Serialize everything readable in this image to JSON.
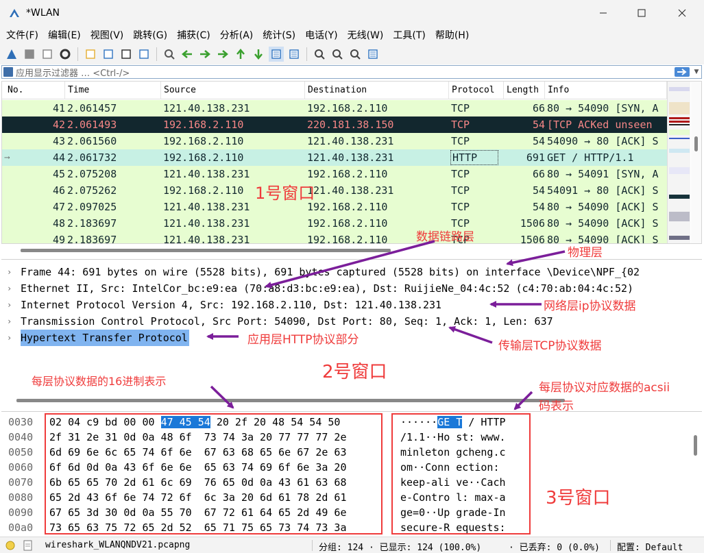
{
  "window": {
    "title": "*WLAN"
  },
  "menu": [
    "文件(F)",
    "编辑(E)",
    "视图(V)",
    "跳转(G)",
    "捕获(C)",
    "分析(A)",
    "统计(S)",
    "电话(Y)",
    "无线(W)",
    "工具(T)",
    "帮助(H)"
  ],
  "toolbar": [
    "shark-fin-start-icon",
    "stop-icon",
    "restart-icon",
    "options-gear-icon",
    "open-folder-icon",
    "save-file-icon",
    "close-file-icon",
    "reload-icon",
    "find-icon",
    "back-arrow-icon",
    "forward-arrow-icon",
    "go-to-packet-icon",
    "first-packet-icon",
    "last-packet-icon",
    "autoscroll-icon",
    "colorize-icon",
    "zoom-in-icon",
    "zoom-out-icon",
    "normal-size-icon",
    "resize-columns-icon"
  ],
  "filter": {
    "placeholder": "应用显示过滤器 … <Ctrl-/>"
  },
  "packet_list": {
    "columns": [
      "No.",
      "Time",
      "Source",
      "Destination",
      "Protocol",
      "Length",
      "Info"
    ],
    "rows": [
      {
        "no": "41",
        "time": "2.061457",
        "src": "121.40.138.231",
        "dst": "192.168.2.110",
        "proto": "TCP",
        "len": "66",
        "info": "80 → 54090 [SYN, A",
        "style": "tcp"
      },
      {
        "no": "42",
        "time": "2.061493",
        "src": "192.168.2.110",
        "dst": "220.181.38.150",
        "proto": "TCP",
        "len": "54",
        "info": "[TCP ACKed unseen",
        "style": "bad"
      },
      {
        "no": "43",
        "time": "2.061560",
        "src": "192.168.2.110",
        "dst": "121.40.138.231",
        "proto": "TCP",
        "len": "54",
        "info": "54090 → 80 [ACK] S",
        "style": "tcp"
      },
      {
        "no": "44",
        "time": "2.061732",
        "src": "192.168.2.110",
        "dst": "121.40.138.231",
        "proto": "HTTP",
        "len": "691",
        "info": "GET / HTTP/1.1",
        "style": "http"
      },
      {
        "no": "45",
        "time": "2.075208",
        "src": "121.40.138.231",
        "dst": "192.168.2.110",
        "proto": "TCP",
        "len": "66",
        "info": "80 → 54091 [SYN, A",
        "style": "tcp"
      },
      {
        "no": "46",
        "time": "2.075262",
        "src": "192.168.2.110",
        "dst": "121.40.138.231",
        "proto": "TCP",
        "len": "54",
        "info": "54091 → 80 [ACK] S",
        "style": "tcp"
      },
      {
        "no": "47",
        "time": "2.097025",
        "src": "121.40.138.231",
        "dst": "192.168.2.110",
        "proto": "TCP",
        "len": "54",
        "info": "80 → 54090 [ACK] S",
        "style": "tcp"
      },
      {
        "no": "48",
        "time": "2.183697",
        "src": "121.40.138.231",
        "dst": "192.168.2.110",
        "proto": "TCP",
        "len": "1506",
        "info": "80 → 54090 [ACK] S",
        "style": "tcp"
      },
      {
        "no": "49",
        "time": "2.183697",
        "src": "121.40.138.231",
        "dst": "192.168.2.110",
        "proto": "TCP",
        "len": "1506",
        "info": "80 → 54090 [ACK] S",
        "style": "tcp"
      }
    ]
  },
  "details": [
    "Frame 44: 691 bytes on wire (5528 bits), 691 bytes captured (5528 bits) on interface \\Device\\NPF_{02",
    "Ethernet II, Src: IntelCor_bc:e9:ea (70:a8:d3:bc:e9:ea), Dst: RuijieNe_04:4c:52 (c4:70:ab:04:4c:52)",
    "Internet Protocol Version 4, Src: 192.168.2.110, Dst: 121.40.138.231",
    "Transmission Control Protocol, Src Port: 54090, Dst Port: 80, Seq: 1, Ack: 1, Len: 637",
    "Hypertext Transfer Protocol"
  ],
  "bytes": [
    {
      "off": "0030",
      "hex": [
        "02 04 c9 bd 00 00 ",
        "47 45 54",
        " 20 2f 20 48 54 54 50"
      ],
      "ascii": [
        "······",
        "GE T",
        " / HTTP"
      ]
    },
    {
      "off": "0040",
      "hex": [
        "2f 31 2e 31 0d 0a 48 6f  73 74 3a 20 77 77 77 2e"
      ],
      "ascii": [
        "/1.1··Ho st: www."
      ]
    },
    {
      "off": "0050",
      "hex": [
        "6d 69 6e 6c 65 74 6f 6e  67 63 68 65 6e 67 2e 63"
      ],
      "ascii": [
        "minleton gcheng.c"
      ]
    },
    {
      "off": "0060",
      "hex": [
        "6f 6d 0d 0a 43 6f 6e 6e  65 63 74 69 6f 6e 3a 20"
      ],
      "ascii": [
        "om··Conn ection: "
      ]
    },
    {
      "off": "0070",
      "hex": [
        "6b 65 65 70 2d 61 6c 69  76 65 0d 0a 43 61 63 68"
      ],
      "ascii": [
        "keep-ali ve··Cach"
      ]
    },
    {
      "off": "0080",
      "hex": [
        "65 2d 43 6f 6e 74 72 6f  6c 3a 20 6d 61 78 2d 61"
      ],
      "ascii": [
        "e-Contro l: max-a"
      ]
    },
    {
      "off": "0090",
      "hex": [
        "67 65 3d 30 0d 0a 55 70  67 72 61 64 65 2d 49 6e"
      ],
      "ascii": [
        "ge=0··Up grade-In"
      ]
    },
    {
      "off": "00a0",
      "hex": [
        "73 65 63 75 72 65 2d 52  65 71 75 65 73 74 73 3a"
      ],
      "ascii": [
        "secure-R equests:"
      ]
    }
  ],
  "status": {
    "file": "wireshark_WLANQNDV21.pcapng",
    "packets": "分组: 124 · 已显示: 124 (100.0%)",
    "dropped": "· 已丢弃: 0 (0.0%)",
    "profile": "配置: Default"
  },
  "annotations": {
    "window1": "1号窗口",
    "window2": "2号窗口",
    "window3": "3号窗口",
    "datalink": "数据链路层",
    "physical": "物理层",
    "network": "网络层ip协议数据",
    "application": "应用层HTTP协议部分",
    "transport": "传输层TCP协议数据",
    "hex_note": "每层协议数据的16进制表示",
    "ascii_note_line1": "每层协议对应数据的acsii",
    "ascii_note_line2": "码表示"
  },
  "colors": {
    "tcp_row": "#e7fdd1",
    "bad_row": "#12272e",
    "bad_text": "#f78787",
    "http_row": "#e4fdf6",
    "annotation_red": "#ef3b3b",
    "arrow_purple": "#7b1e9a",
    "selected_detail": "#80b4f0",
    "byte_highlight": "#1a78d8"
  }
}
